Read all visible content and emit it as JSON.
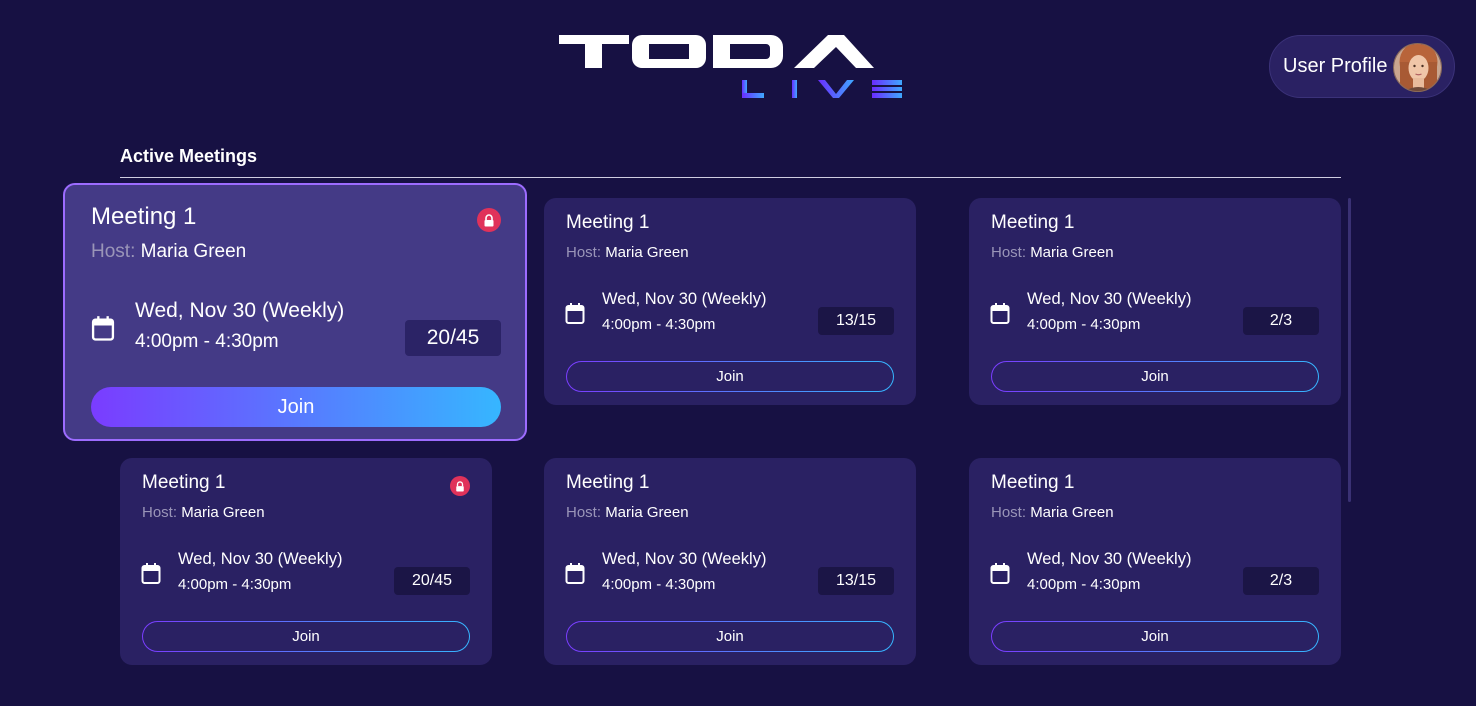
{
  "brand": {
    "logo_wordmark": "TODA",
    "logo_sub": "LIVE"
  },
  "header": {
    "profile_label": "User Profile"
  },
  "section": {
    "title": "Active Meetings"
  },
  "meetings": [
    {
      "title": "Meeting 1",
      "host_label": "Host:",
      "host": "Maria Green",
      "date": "Wed, Nov 30 (Weekly)",
      "time": "4:00pm - 4:30pm",
      "count": "20/45",
      "locked": true,
      "join_label": "Join",
      "featured": true
    },
    {
      "title": "Meeting 1",
      "host_label": "Host:",
      "host": "Maria Green",
      "date": "Wed, Nov 30 (Weekly)",
      "time": "4:00pm - 4:30pm",
      "count": "13/15",
      "locked": false,
      "join_label": "Join"
    },
    {
      "title": "Meeting 1",
      "host_label": "Host:",
      "host": "Maria Green",
      "date": "Wed, Nov 30 (Weekly)",
      "time": "4:00pm - 4:30pm",
      "count": "2/3",
      "locked": false,
      "join_label": "Join"
    },
    {
      "title": "Meeting 1",
      "host_label": "Host:",
      "host": "Maria Green",
      "date": "Wed, Nov 30 (Weekly)",
      "time": "4:00pm - 4:30pm",
      "count": "20/45",
      "locked": true,
      "join_label": "Join"
    },
    {
      "title": "Meeting 1",
      "host_label": "Host:",
      "host": "Maria Green",
      "date": "Wed, Nov 30 (Weekly)",
      "time": "4:00pm - 4:30pm",
      "count": "13/15",
      "locked": false,
      "join_label": "Join"
    },
    {
      "title": "Meeting 1",
      "host_label": "Host:",
      "host": "Maria Green",
      "date": "Wed, Nov 30 (Weekly)",
      "time": "4:00pm - 4:30pm",
      "count": "2/3",
      "locked": false,
      "join_label": "Join"
    }
  ],
  "icons": {
    "calendar": "calendar-icon",
    "lock": "lock-icon",
    "avatar": "user-avatar"
  },
  "colors": {
    "background": "#171143",
    "card": "#2a2163",
    "card_featured": "#443a86",
    "accent_start": "#7a3cff",
    "accent_end": "#36b6ff",
    "lock": "#e0325a"
  }
}
